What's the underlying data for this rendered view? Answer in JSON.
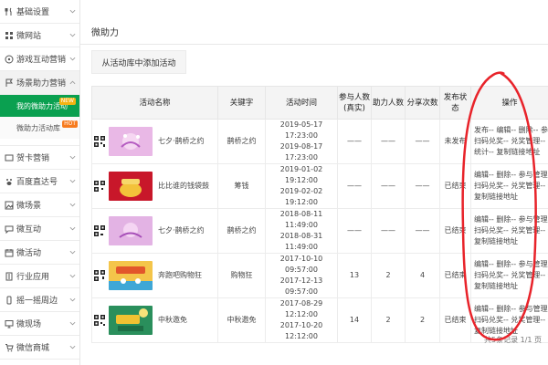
{
  "sidebar": {
    "items": [
      {
        "label": "基础设置",
        "icon": "fork-knife-icon"
      },
      {
        "label": "微网站",
        "icon": "grid-icon"
      },
      {
        "label": "游戏互动营销",
        "icon": "gamepad-icon"
      },
      {
        "label": "场景助力营销",
        "icon": "flag-icon"
      }
    ],
    "submenu": [
      {
        "label": "我的微助力活动",
        "badge": "NEW"
      },
      {
        "label": "微助力活动库",
        "badge": "HOT"
      }
    ],
    "items_after": [
      {
        "label": "贺卡营销",
        "icon": "card-icon"
      },
      {
        "label": "百度直达号",
        "icon": "paw-icon"
      },
      {
        "label": "微场景",
        "icon": "image-icon"
      },
      {
        "label": "微互动",
        "icon": "chat-icon"
      },
      {
        "label": "微活动",
        "icon": "calendar-icon"
      },
      {
        "label": "行业应用",
        "icon": "building-icon"
      },
      {
        "label": "摇一摇周边",
        "icon": "phone-icon"
      },
      {
        "label": "微现场",
        "icon": "monitor-icon"
      },
      {
        "label": "微信商城",
        "icon": "cart-icon"
      }
    ]
  },
  "main": {
    "title": "微助力",
    "add_button": "从活动库中添加活动",
    "table": {
      "headers": [
        "活动名称",
        "关键字",
        "活动时间",
        "参与人数(真实)",
        "助力人数",
        "分享次数",
        "发布状态",
        "操作"
      ],
      "rows": [
        {
          "name": "七夕·鹊桥之约",
          "keyword": "鹊桥之约",
          "time_start": "2019-05-17 17:23:00",
          "time_end": "2019-08-17 17:23:00",
          "participants": "——",
          "helpers": "——",
          "shares": "——",
          "status": "未发布",
          "ops": [
            "发布-- 编辑-- 删除-- 参与管理--",
            "扫码兑奖-- 兑奖管理--",
            "统计-- 复制链接地址"
          ]
        },
        {
          "name": "比比谁的钱袋鼓",
          "keyword": "筹钱",
          "time_start": "2019-01-02 19:12:00",
          "time_end": "2019-02-02 19:12:00",
          "participants": "——",
          "helpers": "——",
          "shares": "——",
          "status": "已结束",
          "ops": [
            "编辑-- 删除-- 参与管理--",
            "扫码兑奖-- 兑奖管理-- 统计--",
            "复制链接地址"
          ]
        },
        {
          "name": "七夕·鹊桥之约",
          "keyword": "鹊桥之约",
          "time_start": "2018-08-11 11:49:00",
          "time_end": "2018-08-31 11:49:00",
          "participants": "——",
          "helpers": "——",
          "shares": "——",
          "status": "已结束",
          "ops": [
            "编辑-- 删除-- 参与管理--",
            "扫码兑奖-- 兑奖管理-- 统计--",
            "复制链接地址"
          ]
        },
        {
          "name": "奔跑吧购物狂",
          "keyword": "购物狂",
          "time_start": "2017-10-10 09:57:00",
          "time_end": "2017-12-13 09:57:00",
          "participants": "13",
          "helpers": "2",
          "shares": "4",
          "status": "已结束",
          "ops": [
            "编辑-- 删除-- 参与管理--",
            "扫码兑奖-- 兑奖管理-- 统计--",
            "复制链接地址"
          ]
        },
        {
          "name": "中秋邀免",
          "keyword": "中秋邀免",
          "time_start": "2017-08-29 12:12:00",
          "time_end": "2017-10-20 12:12:00",
          "participants": "14",
          "helpers": "2",
          "shares": "2",
          "status": "已结束",
          "ops": [
            "编辑-- 删除-- 参与管理--",
            "扫码兑奖-- 兑奖管理-- 统计--",
            "复制链接地址"
          ]
        }
      ]
    },
    "pager": "共5条记录 1/1 页"
  },
  "colors": {
    "accent": "#0aa050",
    "annotation": "#e8232a",
    "badge_new": "#f3b313",
    "badge_hot": "#f77b1e"
  }
}
